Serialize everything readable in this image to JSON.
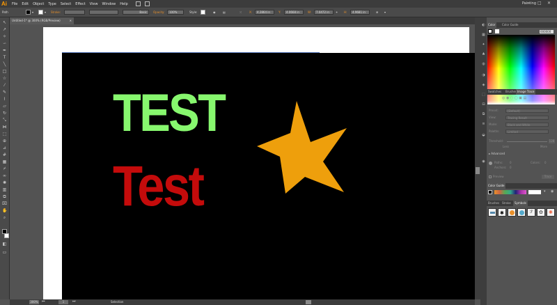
{
  "app": {
    "logo": "Ai",
    "workspace": "Painting"
  },
  "menu": [
    "File",
    "Edit",
    "Object",
    "Type",
    "Select",
    "Effect",
    "View",
    "Window",
    "Help"
  ],
  "control_bar": {
    "selection_label": "Path",
    "stroke_label": "Stroke:",
    "brush_label": "Basic",
    "opacity_label": "Opacity:",
    "opacity_value": "100%",
    "style_label": "Style:",
    "x_value": "4.2864 in",
    "y_value": "4.0668 in",
    "w_value": "7.0472 in",
    "h_value": "4.9681 in"
  },
  "document_tab": {
    "title": "Untitled-1* @ 300% (RGB/Preview)"
  },
  "canvas": {
    "text_upper": "TEST",
    "text_lower": "Test",
    "colors": {
      "upper_text": "#87f76e",
      "lower_text": "#c40b0b",
      "star": "#ee9f0c",
      "background": "#000000"
    }
  },
  "status_bar": {
    "zoom": "300%",
    "page": "1",
    "tool": "Selection"
  },
  "panels": {
    "color_tabs": [
      "Color",
      "Color Guide"
    ],
    "hex_value": "000000",
    "trace_tabs": [
      "Swatches",
      "Brushes",
      "Image Trace"
    ],
    "trace_rows": [
      {
        "label": "Preset:",
        "value": "[Default]"
      },
      {
        "label": "View:",
        "value": "Tracing Result"
      },
      {
        "label": "Mode:",
        "value": "Black and White"
      },
      {
        "label": "Palette:",
        "value": "Limited"
      }
    ],
    "threshold_label": "Threshold:",
    "threshold_value": "128",
    "less_label": "Less",
    "more_label": "More",
    "advanced_label": "Advanced",
    "paths_label": "Paths:",
    "paths_value": "0",
    "colors_label": "Colors:",
    "colors_value": "0",
    "anchors_label": "Anchors:",
    "anchors_value": "0",
    "preview_label": "Preview",
    "trace_button": "Trace",
    "swatch_lib_tab": "Color Guide",
    "symbol_tabs": [
      "Brushes",
      "Stroke",
      "Symbols"
    ]
  }
}
